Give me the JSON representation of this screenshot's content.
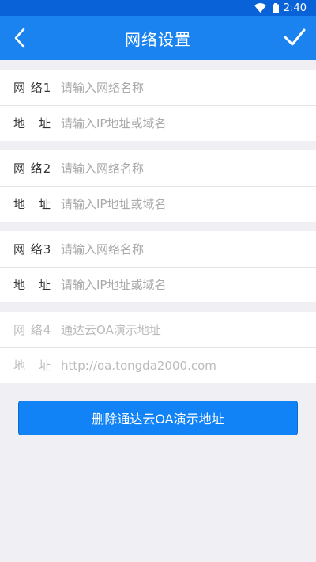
{
  "status_bar": {
    "time": "2:40",
    "icons": [
      "wifi-icon",
      "battery-icon"
    ]
  },
  "header": {
    "title": "网络设置",
    "back_icon": "chevron-left-icon",
    "confirm_icon": "check-icon"
  },
  "networks": [
    {
      "name_label": "网 络1",
      "name_placeholder": "请输入网络名称",
      "addr_label": "地　址",
      "addr_placeholder": "请输入IP地址或域名"
    },
    {
      "name_label": "网 络2",
      "name_placeholder": "请输入网络名称",
      "addr_label": "地　址",
      "addr_placeholder": "请输入IP地址或域名"
    },
    {
      "name_label": "网 络3",
      "name_placeholder": "请输入网络名称",
      "addr_label": "地　址",
      "addr_placeholder": "请输入IP地址或域名"
    },
    {
      "name_label": "网 络4",
      "name_value": "通达云OA演示地址",
      "addr_label": "地　址",
      "addr_value": "http://oa.tongda2000.com"
    }
  ],
  "delete_button": {
    "label": "删除通达云OA演示地址"
  },
  "colors": {
    "status_bar": "#0a62d8",
    "header": "#1a83f0",
    "button": "#1183f7",
    "background": "#efeff4"
  }
}
